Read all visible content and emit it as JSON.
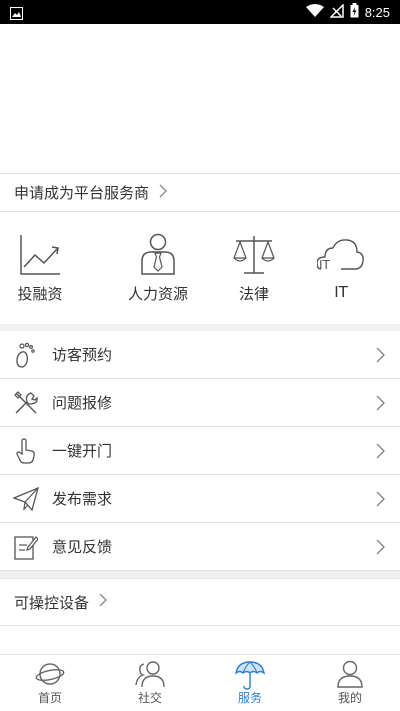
{
  "status_bar": {
    "time": "8:25"
  },
  "apply_row": {
    "label": "申请成为平台服务商"
  },
  "quick_services": [
    {
      "label": "投融资",
      "icon": "chart-trend-icon"
    },
    {
      "label": "人力资源",
      "icon": "person-tie-icon"
    },
    {
      "label": "法律",
      "icon": "scales-icon"
    },
    {
      "label": "IT",
      "icon": "cloud-it-icon"
    }
  ],
  "service_list": [
    {
      "label": "访客预约",
      "icon": "footprint-icon"
    },
    {
      "label": "问题报修",
      "icon": "tools-icon"
    },
    {
      "label": "一键开门",
      "icon": "tap-hand-icon"
    },
    {
      "label": "发布需求",
      "icon": "paper-plane-icon"
    },
    {
      "label": "意见反馈",
      "icon": "feedback-form-icon"
    }
  ],
  "devices_row": {
    "label": "可操控设备"
  },
  "icon_it_text": "IT",
  "tabbar": {
    "items": [
      {
        "label": "首页",
        "icon": "planet-icon"
      },
      {
        "label": "社交",
        "icon": "people-icon"
      },
      {
        "label": "服务",
        "icon": "umbrella-icon",
        "active": true
      },
      {
        "label": "我的",
        "icon": "user-icon"
      }
    ],
    "active_color": "#2e7fd0"
  }
}
